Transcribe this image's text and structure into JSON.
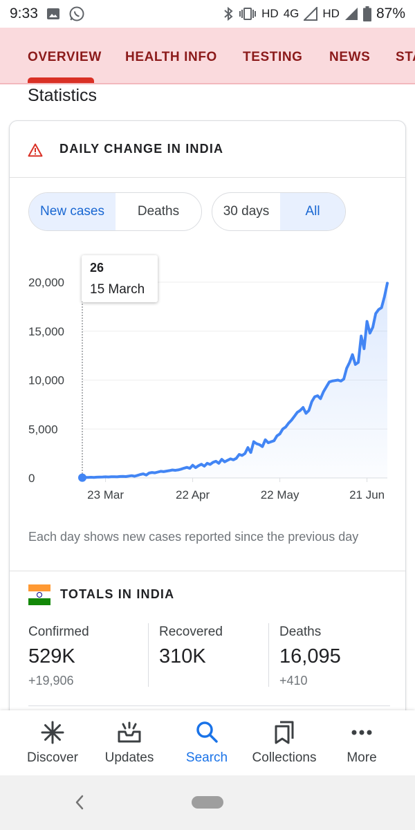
{
  "status_bar": {
    "time": "9:33",
    "network_labels": [
      "HD",
      "4G",
      "HD"
    ],
    "battery": "87%",
    "icons": [
      "image-icon",
      "whatsapp-icon",
      "bluetooth-icon",
      "vibrate-icon",
      "signal-icon",
      "signal-icon",
      "battery-icon"
    ]
  },
  "tabs": [
    {
      "label": "OVERVIEW",
      "active": true
    },
    {
      "label": "HEALTH INFO",
      "active": false
    },
    {
      "label": "TESTING",
      "active": false
    },
    {
      "label": "NEWS",
      "active": false
    },
    {
      "label": "STA",
      "active": false
    }
  ],
  "section_title": "Statistics",
  "card": {
    "title": "DAILY CHANGE IN INDIA",
    "icon": "warning-icon",
    "metric_toggle": [
      {
        "label": "New cases",
        "active": true
      },
      {
        "label": "Deaths",
        "active": false
      }
    ],
    "range_toggle": [
      {
        "label": "30 days",
        "active": false
      },
      {
        "label": "All",
        "active": true
      }
    ],
    "tooltip": {
      "value": "26",
      "date": "15 March"
    },
    "note": "Each day shows new cases reported since the previous day"
  },
  "chart_data": {
    "type": "area",
    "title": "DAILY CHANGE IN INDIA",
    "series": [
      {
        "name": "New cases",
        "x_start": "2020-03-15",
        "x_end": "2020-06-26"
      }
    ],
    "x_tick_labels": [
      "23 Mar",
      "22 Apr",
      "22 May",
      "21 Jun"
    ],
    "y_tick_labels": [
      "0",
      "5,000",
      "10,000",
      "15,000",
      "20,000"
    ],
    "ylim": [
      0,
      20000
    ],
    "y_ticks": [
      0,
      5000,
      10000,
      15000,
      20000
    ],
    "values": [
      26,
      60,
      50,
      70,
      60,
      80,
      90,
      100,
      110,
      100,
      120,
      130,
      110,
      150,
      160,
      140,
      190,
      230,
      180,
      260,
      350,
      420,
      300,
      500,
      560,
      520,
      600,
      680,
      640,
      700,
      750,
      810,
      780,
      820,
      900,
      1000,
      1080,
      980,
      1300,
      1050,
      1250,
      1400,
      1200,
      1500,
      1380,
      1600,
      1700,
      1500,
      1900,
      1650,
      1800,
      1950,
      1850,
      2000,
      2400,
      2300,
      2500,
      3100,
      2600,
      3700,
      3500,
      3400,
      3200,
      3900,
      3600,
      3700,
      3800,
      4300,
      4500,
      5000,
      5200,
      5600,
      5900,
      6300,
      6700,
      6900,
      7200,
      6600,
      6900,
      7800,
      8300,
      8400,
      8100,
      8800,
      9300,
      9800,
      9900,
      9950,
      10000,
      9900,
      10100,
      11200,
      11800,
      12600,
      11600,
      11800,
      14500,
      13200,
      16000,
      14800,
      15400,
      16800,
      17200,
      17400,
      18500,
      19900
    ]
  },
  "totals": {
    "title": "TOTALS IN INDIA",
    "flag": "india-flag-icon",
    "confirmed": {
      "label": "Confirmed",
      "value": "529K",
      "delta": "+19,906"
    },
    "recovered": {
      "label": "Recovered",
      "value": "310K"
    },
    "deaths": {
      "label": "Deaths",
      "value": "16,095",
      "delta": "+410"
    }
  },
  "bottom_nav": [
    {
      "label": "Discover",
      "icon": "discover-icon",
      "active": false
    },
    {
      "label": "Updates",
      "icon": "updates-icon",
      "active": false
    },
    {
      "label": "Search",
      "icon": "search-icon",
      "active": true
    },
    {
      "label": "Collections",
      "icon": "collections-icon",
      "active": false
    },
    {
      "label": "More",
      "icon": "more-icon",
      "active": false
    }
  ],
  "colors": {
    "accent_blue": "#1a73e8",
    "line_blue": "#4285f4",
    "tab_bg": "#fadadd",
    "tab_text": "#8b1a1a",
    "tab_indicator": "#d93025"
  }
}
